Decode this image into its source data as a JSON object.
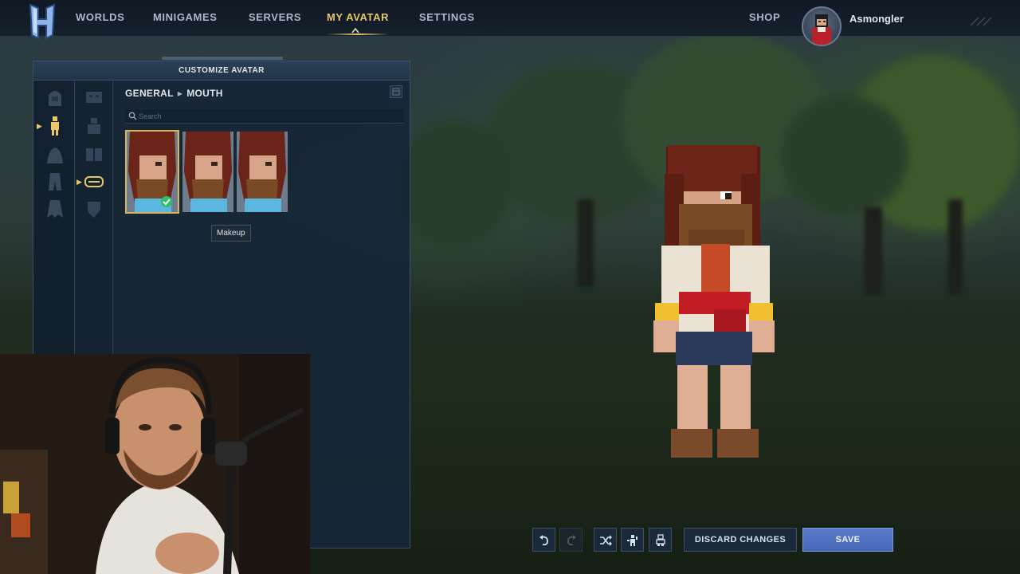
{
  "nav": {
    "items": [
      {
        "label": "WORLDS"
      },
      {
        "label": "MINIGAMES"
      },
      {
        "label": "SERVERS"
      },
      {
        "label": "MY AVATAR",
        "active": true
      },
      {
        "label": "SETTINGS"
      }
    ],
    "shop_label": "SHOP",
    "username": "Asmongler"
  },
  "panel": {
    "title": "CUSTOMIZE AVATAR",
    "breadcrumb": {
      "parent": "GENERAL",
      "current": "MOUTH"
    },
    "search_placeholder": "Search",
    "tooltip": "Makeup",
    "options_count": 3,
    "selected_index": 0
  },
  "toolbar": {
    "discard_label": "DISCARD CHANGES",
    "save_label": "SAVE"
  },
  "colors": {
    "accent": "#e8c76a",
    "save_button": "#4f70c0",
    "panel_bg": "#162636",
    "selected_check": "#2fbf6a"
  },
  "icons": {
    "category_column_1": [
      "head-icon",
      "body-icon",
      "top-icon",
      "legs-icon",
      "cape-icon"
    ],
    "category_column_2": [
      "face-icon",
      "torso-icon",
      "outfit-icon",
      "mouth-icon",
      "shield-icon"
    ],
    "toolbar": [
      "undo-icon",
      "redo-icon",
      "shuffle-icon",
      "emote-icon",
      "preset-icon"
    ]
  }
}
